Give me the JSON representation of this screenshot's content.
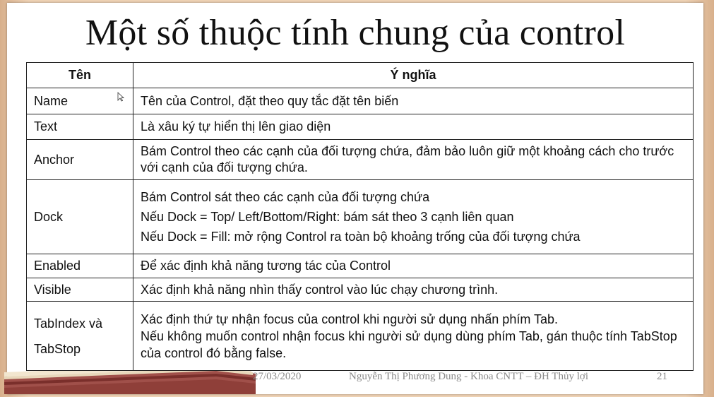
{
  "title": "Một số thuộc tính chung của control",
  "table": {
    "headers": [
      "Tên",
      "Ý nghĩa"
    ],
    "rows": {
      "name": {
        "prop": "Name",
        "desc": "Tên của Control, đặt theo quy tắc đặt tên biến"
      },
      "text": {
        "prop": "Text",
        "desc": "Là xâu ký tự hiển thị lên giao diện"
      },
      "anchor": {
        "prop": "Anchor",
        "desc": "Bám Control theo các cạnh của đối tượng chứa, đảm bảo luôn giữ một khoảng cách cho trước với cạnh của đối tượng chứa."
      },
      "dock": {
        "prop": "Dock",
        "lines": [
          "Bám Control sát theo các cạnh của đối tượng chứa",
          "Nếu Dock = Top/ Left/Bottom/Right: bám sát theo 3 cạnh liên quan",
          "Nếu Dock = Fill: mở rộng Control ra toàn bộ khoảng trống của đối tượng chứa"
        ]
      },
      "enabled": {
        "prop": "Enabled",
        "desc": "Để xác định khả năng tương tác của Control"
      },
      "visible": {
        "prop": "Visible",
        "desc": "Xác định khả năng nhìn thấy control vào lúc chạy chương trình."
      },
      "tab": {
        "prop_lines": [
          "TabIndex và",
          "TabStop"
        ],
        "lines": [
          "Xác định thứ tự nhận focus của control khi người sử dụng nhấn phím Tab.",
          "Nếu không muốn control nhận focus khi người sử dụng dùng phím Tab, gán thuộc tính TabStop của control  đó bằng false."
        ]
      }
    }
  },
  "footer": {
    "date": "27/03/2020",
    "author": "Nguyễn Thị Phương Dung - Khoa CNTT – ĐH Thủy lợi",
    "page": "21"
  }
}
